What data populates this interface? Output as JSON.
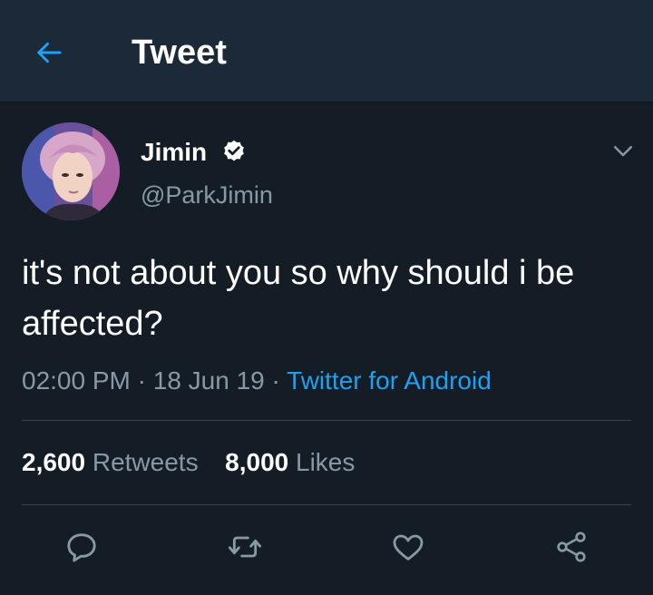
{
  "header": {
    "title": "Tweet",
    "back_icon": "arrow-left-icon"
  },
  "tweet": {
    "author": {
      "name": "Jimin",
      "handle": "@ParkJimin",
      "verified": true
    },
    "text": "it's not about you so why should i be affected?",
    "time": "02:00 PM",
    "date": "18 Jun 19",
    "separator": "·",
    "source": "Twitter for Android",
    "stats": {
      "retweets_count": "2,600",
      "retweets_label": "Retweets",
      "likes_count": "8,000",
      "likes_label": "Likes"
    },
    "actions": [
      "reply-icon",
      "retweet-icon",
      "like-icon",
      "share-icon"
    ]
  },
  "colors": {
    "background": "#141d26",
    "header_background": "#1c2938",
    "accent": "#1da1f2",
    "secondary_text": "#8899a6",
    "divider": "#38444d"
  }
}
